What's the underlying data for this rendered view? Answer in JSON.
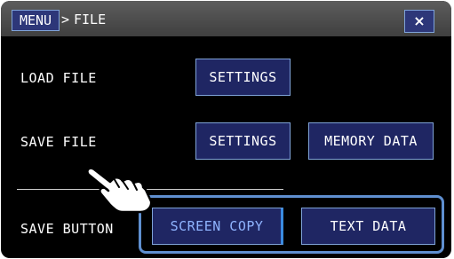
{
  "header": {
    "menu_label": "MENU",
    "separator": ">",
    "title": "FILE",
    "close_label": "×"
  },
  "rows": {
    "load_file": {
      "label": "LOAD FILE",
      "settings_label": "SETTINGS"
    },
    "save_file": {
      "label": "SAVE FILE",
      "settings_label": "SETTINGS",
      "memory_label": "MEMORY DATA"
    },
    "save_button": {
      "label": "SAVE BUTTON",
      "screen_copy_label": "SCREEN COPY",
      "text_data_label": "TEXT DATA"
    }
  },
  "colors": {
    "button_fill": "#1f2663",
    "button_border": "#7fa3d8",
    "selected_text": "#8fb4ff",
    "highlight": "#5f8fd0"
  },
  "icons": {
    "pointer": "pointing-hand-icon",
    "close": "close-icon"
  }
}
